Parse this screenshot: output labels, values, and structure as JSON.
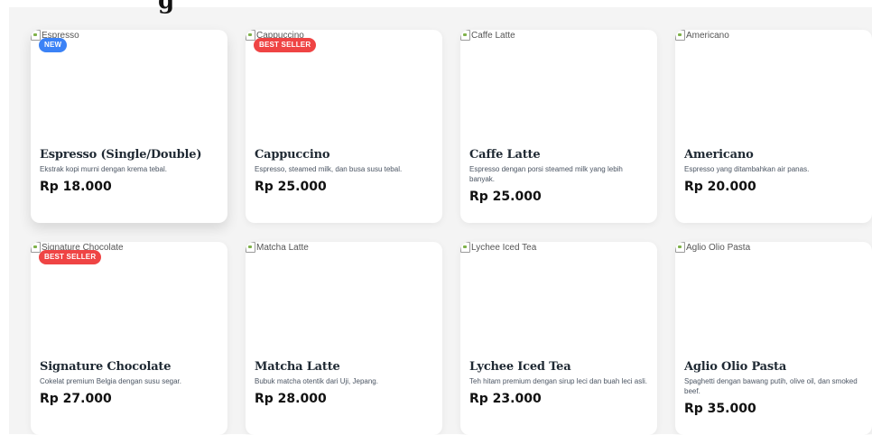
{
  "header": {
    "title": "g"
  },
  "products": [
    {
      "name": "Espresso (Single/Double)",
      "alt": "Espresso",
      "desc": "Ekstrak kopi murni dengan krema tebal.",
      "price": "Rp 18.000",
      "badge": "NEW"
    },
    {
      "name": "Cappuccino",
      "alt": "Cappuccino",
      "desc": "Espresso, steamed milk, dan busa susu tebal.",
      "price": "Rp 25.000",
      "badge": "BEST SELLER"
    },
    {
      "name": "Caffe Latte",
      "alt": "Caffe Latte",
      "desc": "Espresso dengan porsi steamed milk yang lebih banyak.",
      "price": "Rp 25.000",
      "badge": ""
    },
    {
      "name": "Americano",
      "alt": "Americano",
      "desc": "Espresso yang ditambahkan air panas.",
      "price": "Rp 20.000",
      "badge": ""
    },
    {
      "name": "Signature Chocolate",
      "alt": "Signature Chocolate",
      "desc": "Cokelat premium Belgia dengan susu segar.",
      "price": "Rp 27.000",
      "badge": "BEST SELLER"
    },
    {
      "name": "Matcha Latte",
      "alt": "Matcha Latte",
      "desc": "Bubuk matcha otentik dari Uji, Jepang.",
      "price": "Rp 28.000",
      "badge": ""
    },
    {
      "name": "Lychee Iced Tea",
      "alt": "Lychee Iced Tea",
      "desc": "Teh hitam premium dengan sirup leci dan buah leci asli.",
      "price": "Rp 23.000",
      "badge": ""
    },
    {
      "name": "Aglio Olio Pasta",
      "alt": "Aglio Olio Pasta",
      "desc": "Spaghetti dengan bawang putih, olive oil, dan smoked beef.",
      "price": "Rp 35.000",
      "badge": ""
    }
  ],
  "colors": {
    "new_badge": "#3b82f6",
    "best_seller_badge": "#ef4444"
  }
}
